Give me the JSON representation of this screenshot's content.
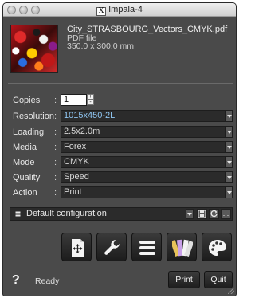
{
  "window": {
    "title": "Impala-4",
    "x_icon_glyph": "X"
  },
  "file": {
    "name": "City_STRASBOURG_Vectors_CMYK.pdf",
    "type": "PDF file",
    "size": "350.0 x 300.0 mm"
  },
  "form": {
    "copies": {
      "label": "Copies",
      "value": "1"
    },
    "resolution": {
      "label": "Resolution",
      "value": "1015x450-2L"
    },
    "loading": {
      "label": "Loading",
      "value": "2.5x2.0m"
    },
    "media": {
      "label": "Media",
      "value": "Forex"
    },
    "mode": {
      "label": "Mode",
      "value": "CMYK"
    },
    "quality": {
      "label": "Quality",
      "value": "Speed"
    },
    "action": {
      "label": "Action",
      "value": "Print"
    }
  },
  "colon": ":",
  "configuration": {
    "label": "Default configuration",
    "more_label": "..."
  },
  "tools": [
    {
      "name": "layout-tool",
      "icon": "crop-move-icon"
    },
    {
      "name": "settings-tool",
      "icon": "wrench-icon"
    },
    {
      "name": "queue-tool",
      "icon": "list-icon"
    },
    {
      "name": "swatch-tool",
      "icon": "color-swatch-icon"
    },
    {
      "name": "palette-tool",
      "icon": "palette-icon"
    }
  ],
  "footer": {
    "help": "?",
    "status": "Ready",
    "print_label": "Print",
    "quit_label": "Quit"
  },
  "colors": {
    "panel_bg": "#4a4a4a",
    "field_bg": "#2b2b2b",
    "accent_text": "#8ec4f0"
  }
}
